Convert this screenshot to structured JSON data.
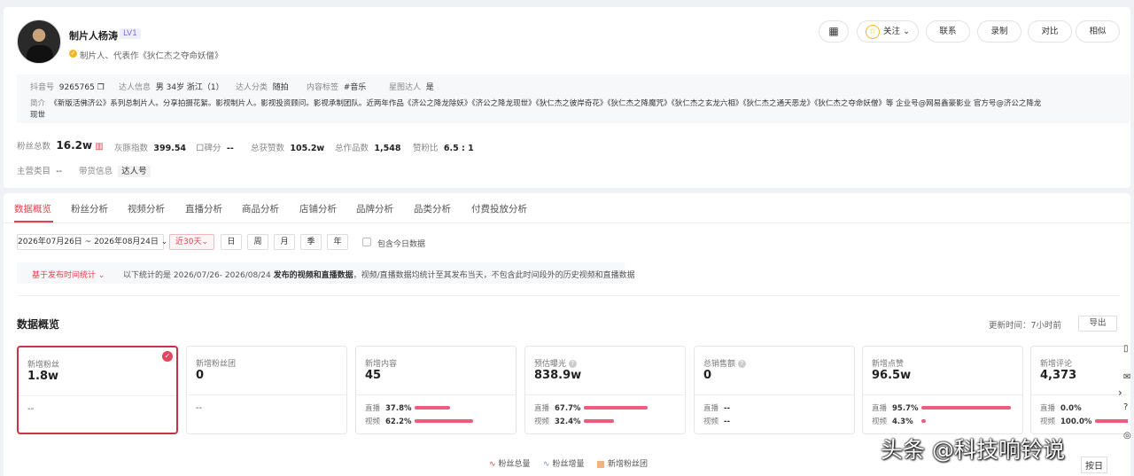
{
  "profile": {
    "name": "制片人杨涛",
    "level": "LV1",
    "subtitle": "制片人、代表作《狄仁杰之夺命妖僧》",
    "buttons": {
      "follow": "关注",
      "contact": "联系",
      "record": "录制",
      "compare": "对比",
      "similar": "相似"
    },
    "info": {
      "douyin_label": "抖音号",
      "douyin_value": "9265765",
      "talent_label": "达人信息",
      "talent_value": "男 34岁 浙江（1）",
      "category_label": "达人分类",
      "category_value": "随拍",
      "tag_label": "内容标签",
      "tag_value": "#音乐",
      "star_label": "星图达人",
      "star_value": "是",
      "intro_label": "简介",
      "intro_line1": "《新版活佛济公》系列总制片人。分享拍摄花絮。影视制片人。影视投资顾问。影视承制团队。近两年作品《济公之降龙除妖》《济公之降龙现世》《狄仁杰之彼岸奇花》《狄仁杰之降魔咒》《狄仁杰之玄龙六相》《狄仁杰之通天恶龙》《狄仁杰之夺命妖僧》等 企业号@网易鑫豪影业 官方号@济公之降龙",
      "intro_line2": "现世"
    },
    "stats": {
      "fans_label": "粉丝总数",
      "fans_value": "16.2w",
      "gray_label": "灰豚指数",
      "gray_value": "399.54",
      "rep_label": "口碑分",
      "rep_value": "--",
      "likes_label": "总获赞数",
      "likes_value": "105.2w",
      "works_label": "总作品数",
      "works_value": "1,548",
      "ratio_label": "赞粉比",
      "ratio_value": "6.5 : 1"
    },
    "main_cat_label": "主营类目",
    "main_cat_value": "--",
    "goods_label": "带货信息",
    "goods_value": "达人号"
  },
  "tabs": [
    "数据概览",
    "粉丝分析",
    "视频分析",
    "直播分析",
    "商品分析",
    "店铺分析",
    "品牌分析",
    "品类分析",
    "付费投放分析"
  ],
  "filters": {
    "date_range": "2026年07月26日 ~ 2026年08月24日",
    "recent": "近30天",
    "periods": [
      "日",
      "周",
      "月",
      "季",
      "年"
    ],
    "include_today": "包含今日数据",
    "basis": "基于发布时间统计",
    "basis_note_a": "以下统计的是 2026/07/26- 2026/08/24",
    "basis_note_b": "发布的视频和直播数据",
    "basis_note_c": "，视频/直播数据均统计至其发布当天，不包含此时间段外的历史视频和直播数据"
  },
  "overview": {
    "title": "数据概览",
    "updated": "更新时间：7小时前",
    "export": "导出",
    "metrics": [
      {
        "label": "新增粉丝",
        "value": "1.8w",
        "empty": "--"
      },
      {
        "label": "新增粉丝团",
        "value": "0",
        "empty": "--"
      },
      {
        "label": "新增内容",
        "value": "45",
        "live_label": "直播",
        "live_pct": "37.8%",
        "video_label": "视频",
        "video_pct": "62.2%",
        "live_fill": 0.378,
        "video_fill": 0.622
      },
      {
        "label": "预估曝光",
        "value": "838.9w",
        "live_label": "直播",
        "live_pct": "67.7%",
        "video_label": "视频",
        "video_pct": "32.4%",
        "live_fill": 0.677,
        "video_fill": 0.324
      },
      {
        "label": "总销售额",
        "value": "0",
        "live_label": "直播",
        "live_pct": "--",
        "video_label": "视频",
        "video_pct": "--"
      },
      {
        "label": "新增点赞",
        "value": "96.5w",
        "live_label": "直播",
        "live_pct": "95.7%",
        "video_label": "视频",
        "video_pct": "4.3%",
        "live_fill": 0.957,
        "video_fill": 0.043
      },
      {
        "label": "新增评论",
        "value": "4,373",
        "live_label": "直播",
        "live_pct": "0.0%",
        "video_label": "视频",
        "video_pct": "100.0%",
        "live_fill": 0.0,
        "video_fill": 1.0
      }
    ],
    "legend": [
      "粉丝总量",
      "粉丝增量",
      "新增粉丝团"
    ]
  },
  "watermark": "头条 @科技响铃说",
  "day_button": "按日",
  "colors": {
    "accent": "#e5404c",
    "bar": "#ec5c7d",
    "legend_blue": "#7b8bd6",
    "legend_orange": "#f5b37a"
  }
}
